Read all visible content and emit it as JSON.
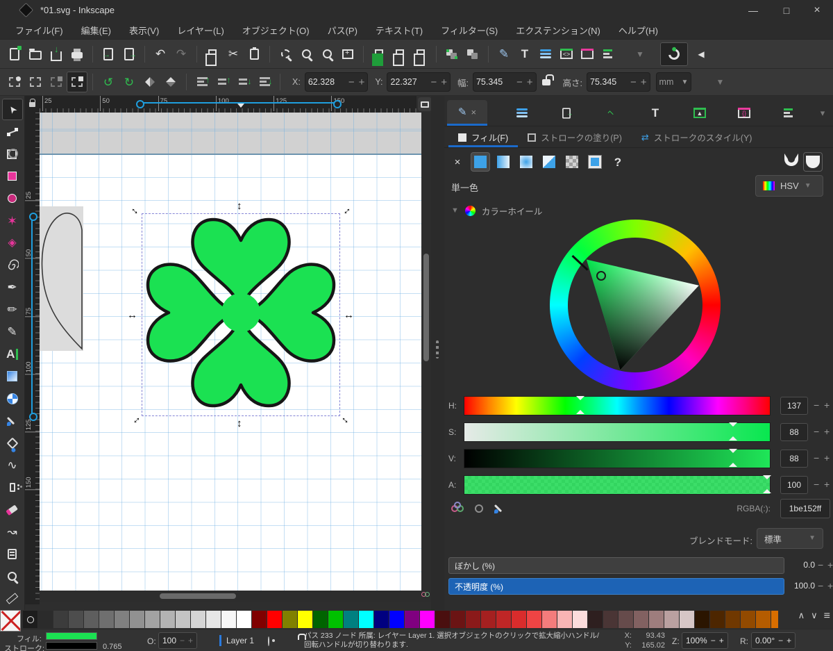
{
  "titlebar": {
    "title": "*01.svg - Inkscape"
  },
  "menu": {
    "items": [
      "ファイル(F)",
      "編集(E)",
      "表示(V)",
      "レイヤー(L)",
      "オブジェクト(O)",
      "パス(P)",
      "テキスト(T)",
      "フィルター(S)",
      "エクステンション(N)",
      "ヘルプ(H)"
    ]
  },
  "toolbar": {
    "x_label": "X:",
    "x_value": "62.328",
    "y_label": "Y:",
    "y_value": "22.327",
    "w_label": "幅:",
    "w_value": "75.345",
    "h_label": "高さ:",
    "h_value": "75.345",
    "unit": "mm"
  },
  "rulers": {
    "horizontal": [
      "25",
      "50",
      "75",
      "100",
      "125",
      "150"
    ],
    "vertical": [
      "25",
      "50",
      "75",
      "100",
      "125",
      "150"
    ]
  },
  "dock": {
    "fill_tab": "フィル(F)",
    "stroke_paint_tab": "ストロークの塗り(P)",
    "stroke_style_tab": "ストロークのスタイル(Y)",
    "flat_color_label": "単一色",
    "picker_mode": "HSV",
    "wheel_label": "カラーホイール",
    "unknown_paint": "?",
    "sliders": [
      {
        "label": "H:",
        "value": "137",
        "pos": 38
      },
      {
        "label": "S:",
        "value": "88",
        "pos": 88
      },
      {
        "label": "V:",
        "value": "88",
        "pos": 88
      },
      {
        "label": "A:",
        "value": "100",
        "pos": 99
      }
    ],
    "rgba_label": "RGBA(:):",
    "rgba_value": "1be152ff",
    "blend_label": "ブレンドモード:",
    "blend_value": "標準",
    "blur_label": "ぼかし (%)",
    "blur_value": "0.0",
    "opacity_label": "不透明度 (%)",
    "opacity_value": "100.0"
  },
  "statusbar": {
    "fill_label": "フィル:",
    "stroke_label": "ストローク:",
    "stroke_width": "0.765",
    "opacity_label": "O:",
    "opacity_value": "100",
    "layer_name": "Layer 1",
    "message": "パス 233 ノード 所属: レイヤー Layer 1. 選択オブジェクトのクリックで拡大縮小ハンドル/回転ハンドルが切り替わります.",
    "x_label": "X:",
    "x_value": "93.43",
    "y_label": "Y:",
    "y_value": "165.02",
    "zoom_label": "Z:",
    "zoom_value": "100%",
    "rotation_label": "R:",
    "rotation_value": "0.00°"
  },
  "colors": {
    "object_fill": "#1be152",
    "accent_blue": "#1b6acb",
    "selection_dash": "#8585d6"
  },
  "palette": {
    "colors": [
      "#2b2b2b",
      "#3c3c3c",
      "#4d4d4d",
      "#5e5e5e",
      "#6f6f6f",
      "#808080",
      "#919191",
      "#a2a2a2",
      "#b3b3b3",
      "#c4c4c4",
      "#d5d5d5",
      "#e6e6e6",
      "#f7f7f7",
      "#ffffff",
      "#800000",
      "#ff0000",
      "#808000",
      "#ffff00",
      "#006400",
      "#00c000",
      "#008080",
      "#00ffff",
      "#000080",
      "#0000ff",
      "#800080",
      "#ff00ff",
      "#4a0f0f",
      "#6b1414",
      "#8b1a1a",
      "#a52020",
      "#bf2626",
      "#d92c2c",
      "#ef4444",
      "#f47c7c",
      "#f8b4b4",
      "#fcdcdc",
      "#2e1f1f",
      "#4a3535",
      "#664b4b",
      "#826161",
      "#9e7d7d",
      "#baa0a0",
      "#d6c6c6",
      "#2b1500",
      "#4d2600",
      "#703800",
      "#924a00",
      "#b55c00",
      "#d86e00",
      "#f98307",
      "#ff9c2e",
      "#ffb561",
      "#ffcf94",
      "#ffe3c2"
    ]
  },
  "icons": {
    "undo": "↶",
    "redo": "↷",
    "cut": "✂",
    "select": "➤",
    "star": "✶",
    "box3d": "◈",
    "pen": "✒",
    "pencil": "✏",
    "calligraphy": "✎",
    "text": "A",
    "tweak": "∿",
    "connector": "↝",
    "help": "?",
    "close": "×",
    "chevron_down": "▾",
    "dropdown": "▼",
    "minus": "−",
    "plus": "+",
    "minimize": "—",
    "maximize": "□",
    "collapse": "◀",
    "up": "∧",
    "down": "∨",
    "menu": "≡",
    "rotate_ccw": "↺",
    "rotate_cw": "↻",
    "text_dialog": "T",
    "spiral": "ⓢ"
  }
}
